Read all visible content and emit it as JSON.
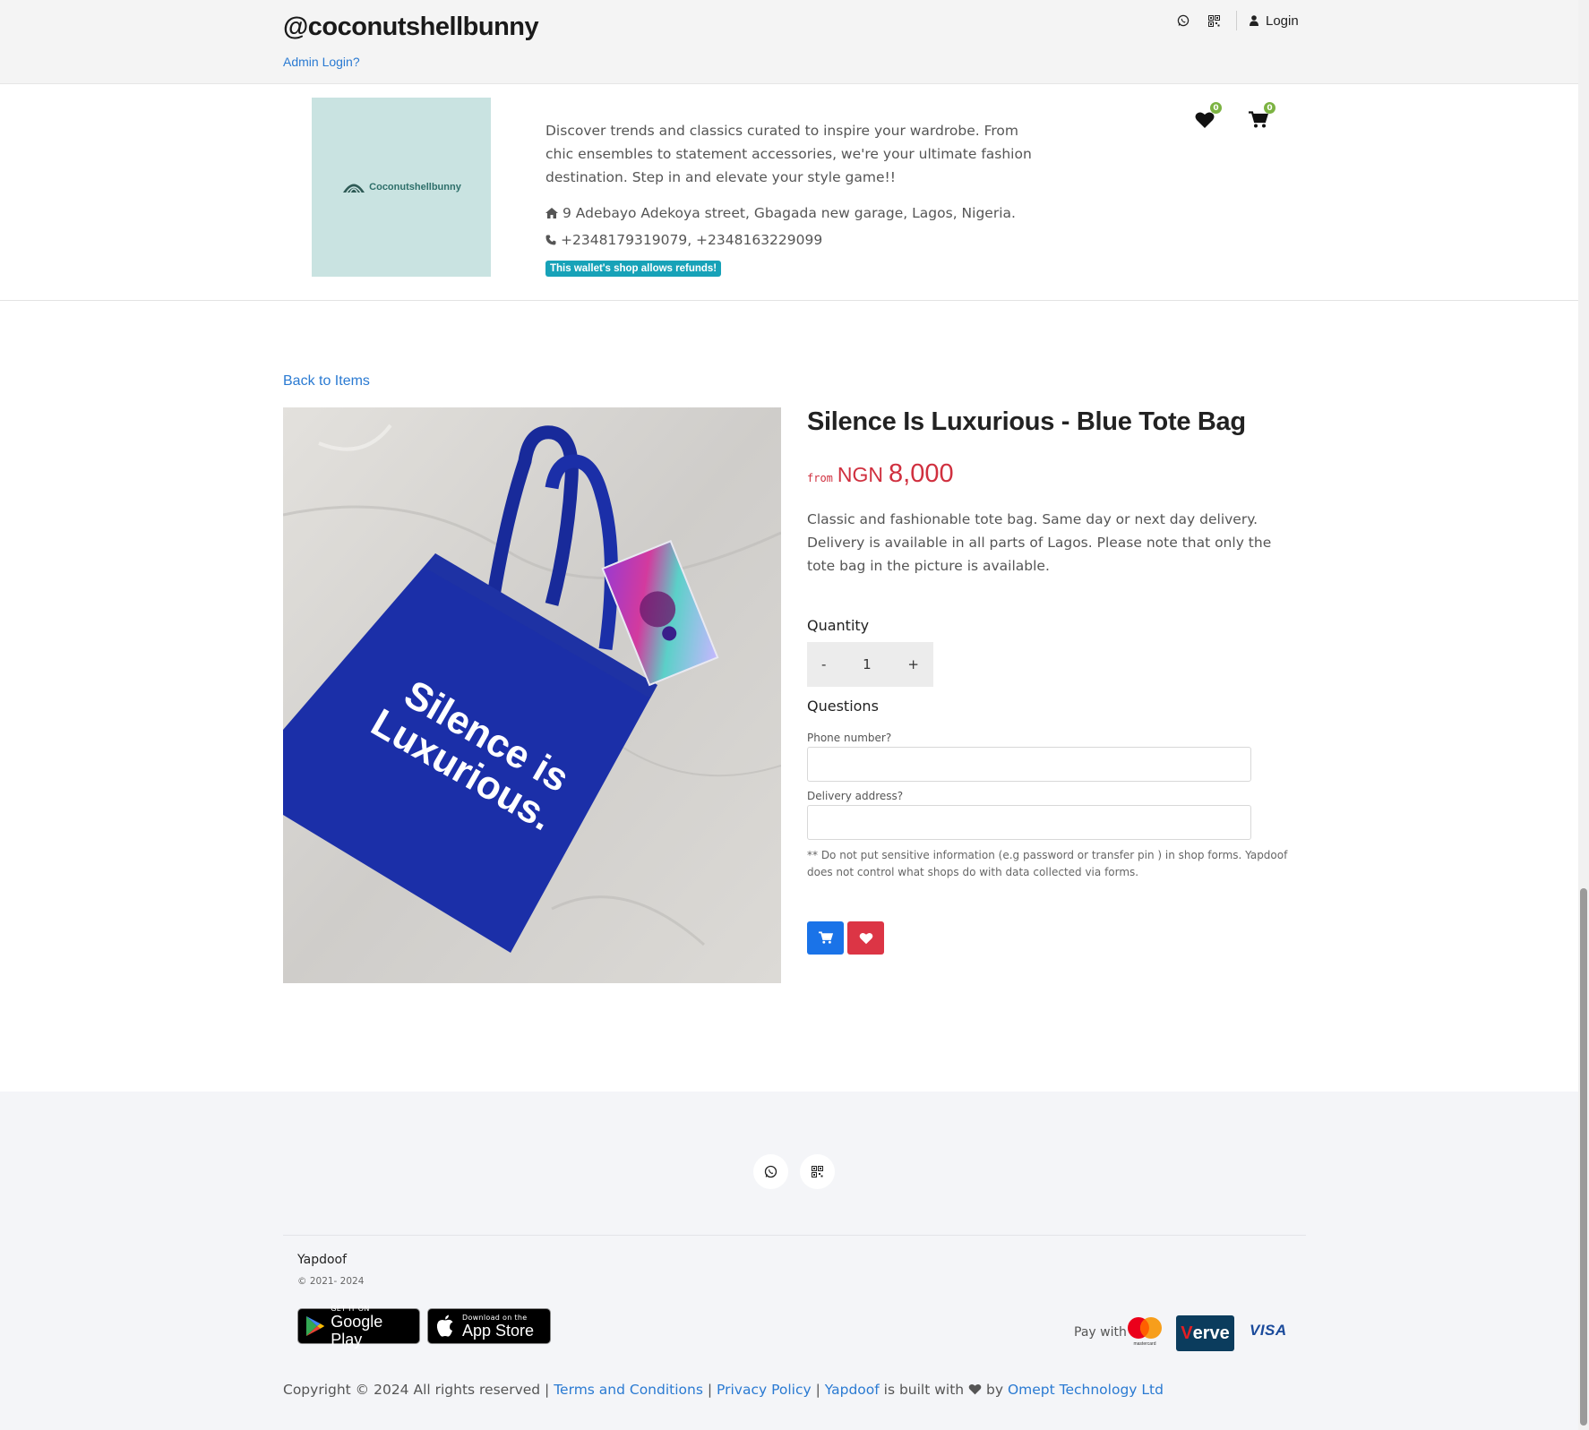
{
  "header": {
    "shop_handle": "@coconutshellbunny",
    "admin_login": "Admin Login?",
    "login_label": "Login"
  },
  "shop": {
    "logo_text": "Coconutshellbunny",
    "description": "Discover trends and classics curated to inspire your wardrobe. From chic ensembles to statement accessories, we're your ultimate fashion destination. Step in and elevate your style game!!",
    "address": "9 Adebayo Adekoya street, Gbagada new garage, Lagos, Nigeria.",
    "phones": "+2348179319079, +2348163229099",
    "refund_badge": "This wallet's shop allows refunds!",
    "wishlist_count": "0",
    "cart_count": "0"
  },
  "product": {
    "back_link": "Back to Items",
    "image_text": "Silence is Luxurious.",
    "title": "Silence Is Luxurious - Blue Tote Bag",
    "price_prefix": "from",
    "currency": "NGN",
    "price": "8,000",
    "description": "Classic and fashionable tote bag. Same day or next day delivery. Delivery is available in all parts of Lagos. Please note that only the tote bag in the picture is available.",
    "quantity_label": "Quantity",
    "quantity_minus": "-",
    "quantity_value": "1",
    "quantity_plus": "+",
    "questions_label": "Questions",
    "field_phone_label": "Phone number?",
    "field_address_label": "Delivery address?",
    "form_note": "** Do not put sensitive information (e.g password or transfer pin ) in shop forms. Yapdoof does not control what shops do with data collected via forms."
  },
  "footer": {
    "brand": "Yapdoof",
    "year": "© 2021- 2024",
    "google_play_small": "GET IT ON",
    "google_play_big": "Google Play",
    "app_store_small": "Download on the",
    "app_store_big": "App Store",
    "pay_with": "Pay with",
    "mastercard_label": "mastercard",
    "verve_v": "V",
    "verve_rest": "erve",
    "visa": "VISA",
    "copyright_text": "Copyright © 2024 All rights reserved |",
    "terms": "Terms and Conditions",
    "sep1": "|",
    "privacy": "Privacy Policy",
    "sep2": "|",
    "yapdoof": "Yapdoof",
    "built_with": "is built with",
    "by": "by",
    "company": "Omept Technology Ltd"
  },
  "colors": {
    "accent_link": "#2a7ad2",
    "price_red": "#d0303f",
    "badge_teal": "#17a2b8",
    "count_green": "#7cb342",
    "cart_button": "#1a73e8",
    "wishlist_button": "#dc3545",
    "tote_blue": "#1b2fa8"
  },
  "icons": [
    "whatsapp-icon",
    "qrcode-icon",
    "user-icon",
    "heart-icon",
    "cart-icon",
    "home-icon",
    "phone-icon"
  ]
}
